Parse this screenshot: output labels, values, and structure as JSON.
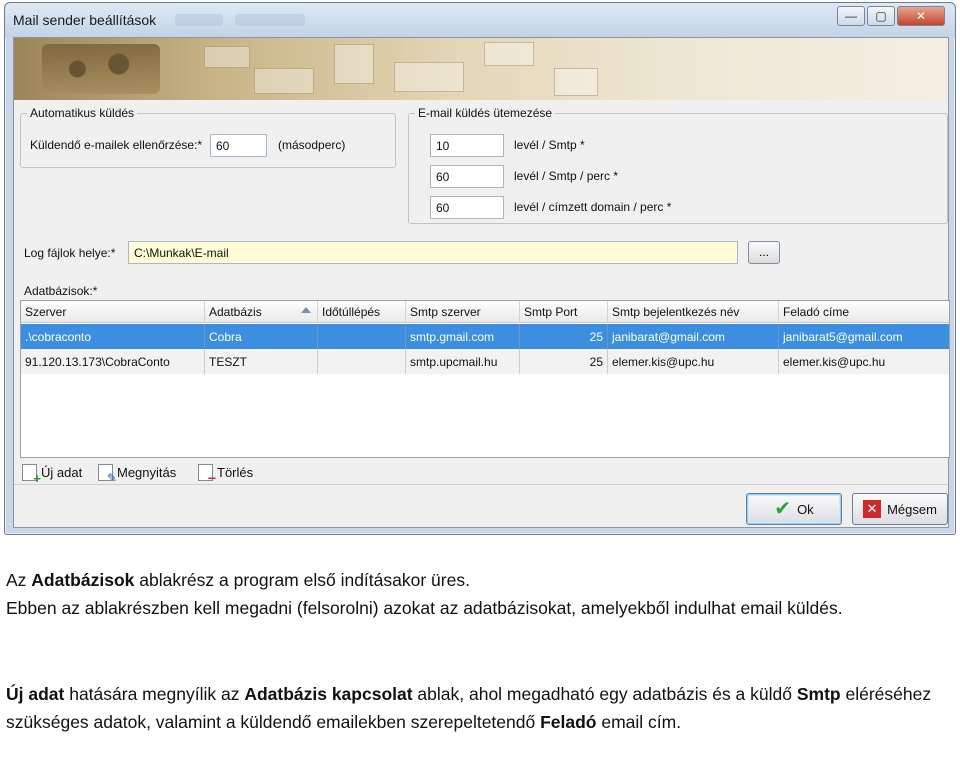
{
  "window": {
    "title": "Mail sender beállítások",
    "controls": {
      "minimize": "—",
      "maximize": "▢",
      "close": "✕"
    }
  },
  "auto_send": {
    "legend": "Automatikus küldés",
    "check_label": "Küldendő e-mailek ellenőrzése:*",
    "check_value": "60",
    "unit": "(másodperc)"
  },
  "schedule": {
    "legend": "E-mail küldés ütemezése",
    "items": [
      {
        "value": "10",
        "label": "levél / Smtp *"
      },
      {
        "value": "60",
        "label": "levél / Smtp / perc *"
      },
      {
        "value": "60",
        "label": "levél / címzett domain / perc *"
      }
    ]
  },
  "log": {
    "label": "Log fájlok helye:*",
    "value": "C:\\Munkak\\E-mail",
    "browse_label": "..."
  },
  "databases": {
    "label": "Adatbázisok:*",
    "columns": [
      "Szerver",
      "Adatbázis",
      "Időtúllépés",
      "Smtp szerver",
      "Smtp Port",
      "Smtp bejelentkezés név",
      "Feladó címe"
    ],
    "rows": [
      [
        ".\\cobraconto",
        "Cobra",
        "",
        "smtp.gmail.com",
        "25",
        "janibarat@gmail.com",
        "janibarat5@gmail.com"
      ],
      [
        "91.120.13.173\\CobraConto",
        "TESZT",
        "",
        "smtp.upcmail.hu",
        "25",
        "elemer.kis@upc.hu",
        "elemer.kis@upc.hu"
      ]
    ]
  },
  "toolbar": {
    "new_label": "Új adat",
    "open_label": "Megnyitás",
    "delete_label": "Törlés"
  },
  "buttons": {
    "ok_label": "Ok",
    "cancel_label": "Mégsem"
  },
  "description": {
    "p1_a": "Az ",
    "p1_b": "Adatbázisok",
    "p1_c": " ablakrész a program első indításakor üres.",
    "p1_d": "Ebben az ablakrészben kell megadni (felsorolni) azokat az adatbázisokat, amelyekből indulhat email küldés.",
    "p2_a": "Új adat",
    "p2_b": " hatására megnyílik az ",
    "p2_c": "Adatbázis kapcsolat",
    "p2_d": " ablak, ahol megadható egy adatbázis és a küldő ",
    "p2_e": "Smtp",
    "p2_f": " eléréséhez szükséges adatok, valamint a küldendő emailekben szerepeltetendő ",
    "p2_g": "Feladó",
    "p2_h": " email cím."
  },
  "colors": {
    "selection": "#3c8fe0",
    "log_field_bg": "#fffdd8",
    "ok_check": "#24a62f",
    "cancel_x": "#cf2a2a"
  }
}
